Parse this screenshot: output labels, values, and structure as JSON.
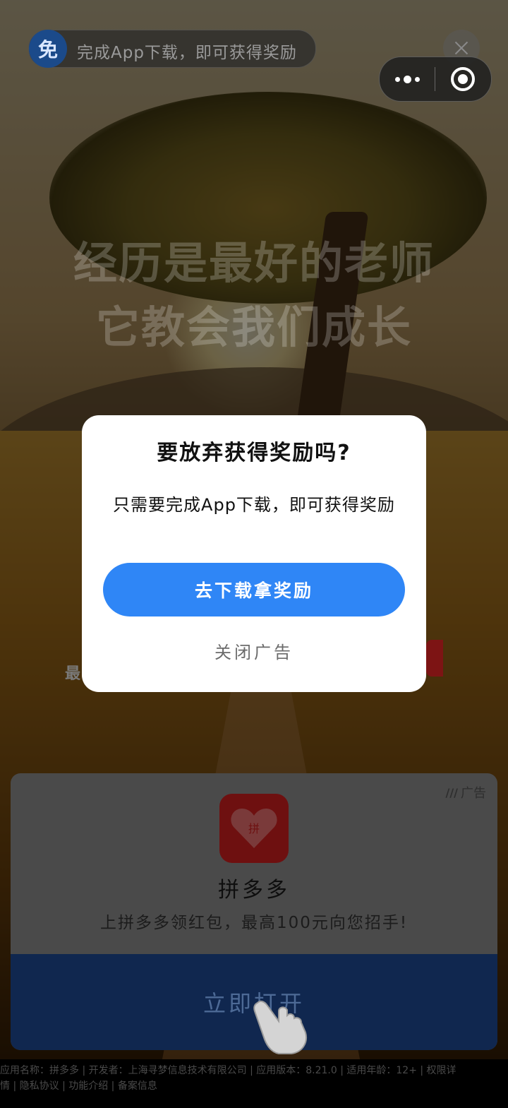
{
  "top_bar": {
    "reward_badge": "免",
    "reward_text": "完成App下载，即可获得奖励"
  },
  "video": {
    "quote_line1": "经历是最好的老师",
    "quote_line2": "它教会我们成长",
    "peek_text": "最"
  },
  "dialog": {
    "title": "要放弃获得奖励吗?",
    "body": "只需要完成App下载，即可获得奖励",
    "primary_label": "去下载拿奖励",
    "secondary_label": "关闭广告"
  },
  "ad": {
    "tag": "广告",
    "app_name": "拼多多",
    "icon_char": "拼",
    "slogan": "上拼多多领红包，最高100元向您招手!",
    "cta": "立即打开"
  },
  "footer": {
    "line1": "应用名称：拼多多 | 开发者：上海寻梦信息技术有限公司 | 应用版本：8.21.0 | 适用年龄：12+ | 权限详",
    "line2": "情 | 隐私协议 | 功能介绍 | 备案信息"
  },
  "colors": {
    "primary_blue": "#2f86f6",
    "brand_red": "#e02e24",
    "dialog_bg": "#ffffff"
  }
}
